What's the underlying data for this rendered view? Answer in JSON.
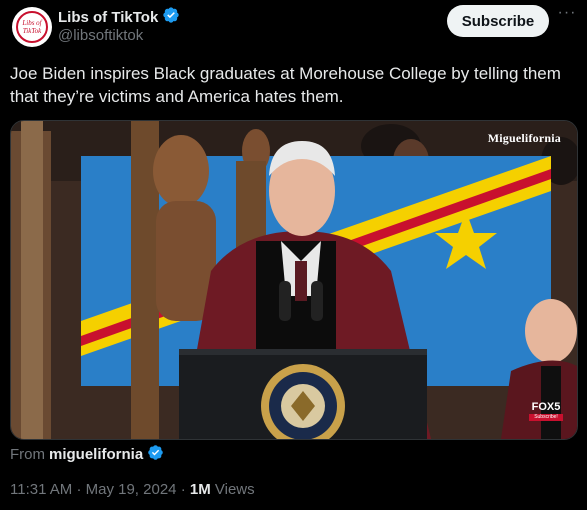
{
  "header": {
    "display_name": "Libs of TikTok",
    "handle": "@libsoftiktok",
    "avatar_text_line1": "Libs of",
    "avatar_text_line2": "TikTok",
    "subscribe_label": "Subscribe",
    "more_icon": "more-horizontal-icon"
  },
  "tweet": {
    "text": "Joe Biden inspires Black graduates at Morehouse College by telling them that they’re victims and America hates them."
  },
  "media": {
    "watermark": "Miguelifornia",
    "broadcaster_logo": "FOX5",
    "broadcaster_sub": "Subscribe!"
  },
  "source": {
    "from_label": "From",
    "from_name": "miguelifornia"
  },
  "meta": {
    "time": "11:31 AM",
    "separator": "·",
    "date": "May 19, 2024",
    "views_count": "1M",
    "views_label": "Views"
  },
  "colors": {
    "verified": "#1d9bf0",
    "secondary_text": "#71767b",
    "primary_text": "#e7e9ea",
    "background": "#000000"
  }
}
